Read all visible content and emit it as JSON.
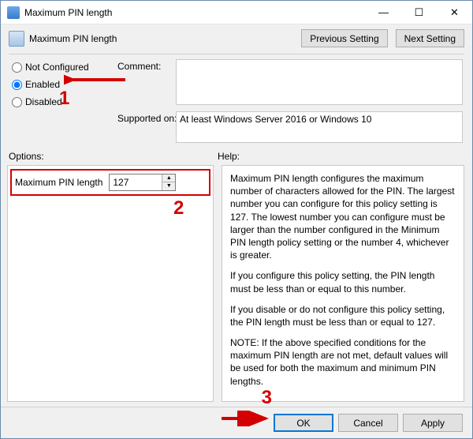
{
  "window": {
    "title": "Maximum PIN length",
    "minimize": "—",
    "maximize": "☐",
    "close": "✕"
  },
  "header": {
    "name": "Maximum PIN length",
    "prev": "Previous Setting",
    "next": "Next Setting"
  },
  "state": {
    "not_configured": "Not Configured",
    "enabled": "Enabled",
    "disabled": "Disabled",
    "selected": "enabled"
  },
  "labels": {
    "comment": "Comment:",
    "supported": "Supported on:",
    "options": "Options:",
    "help": "Help:"
  },
  "comment": "",
  "supported_text": "At least Windows Server 2016 or Windows 10",
  "options": {
    "pin_label": "Maximum PIN length",
    "pin_value": "127"
  },
  "help": {
    "p1": "Maximum PIN length configures the maximum number of characters allowed for the PIN.  The largest number you can configure for this policy setting is 127. The lowest number you can configure must be larger than the number configured in the Minimum PIN length policy setting or the number 4, whichever is greater.",
    "p2": "If you configure this policy setting, the PIN length must be less than or equal to this number.",
    "p3": "If you disable or do not configure this policy setting, the PIN length must be less than or equal to 127.",
    "p4": "NOTE: If the above specified conditions for the maximum PIN length are not met, default values will be used for both the maximum and minimum PIN lengths."
  },
  "footer": {
    "ok": "OK",
    "cancel": "Cancel",
    "apply": "Apply"
  },
  "annotations": {
    "n1": "1",
    "n2": "2",
    "n3": "3"
  }
}
